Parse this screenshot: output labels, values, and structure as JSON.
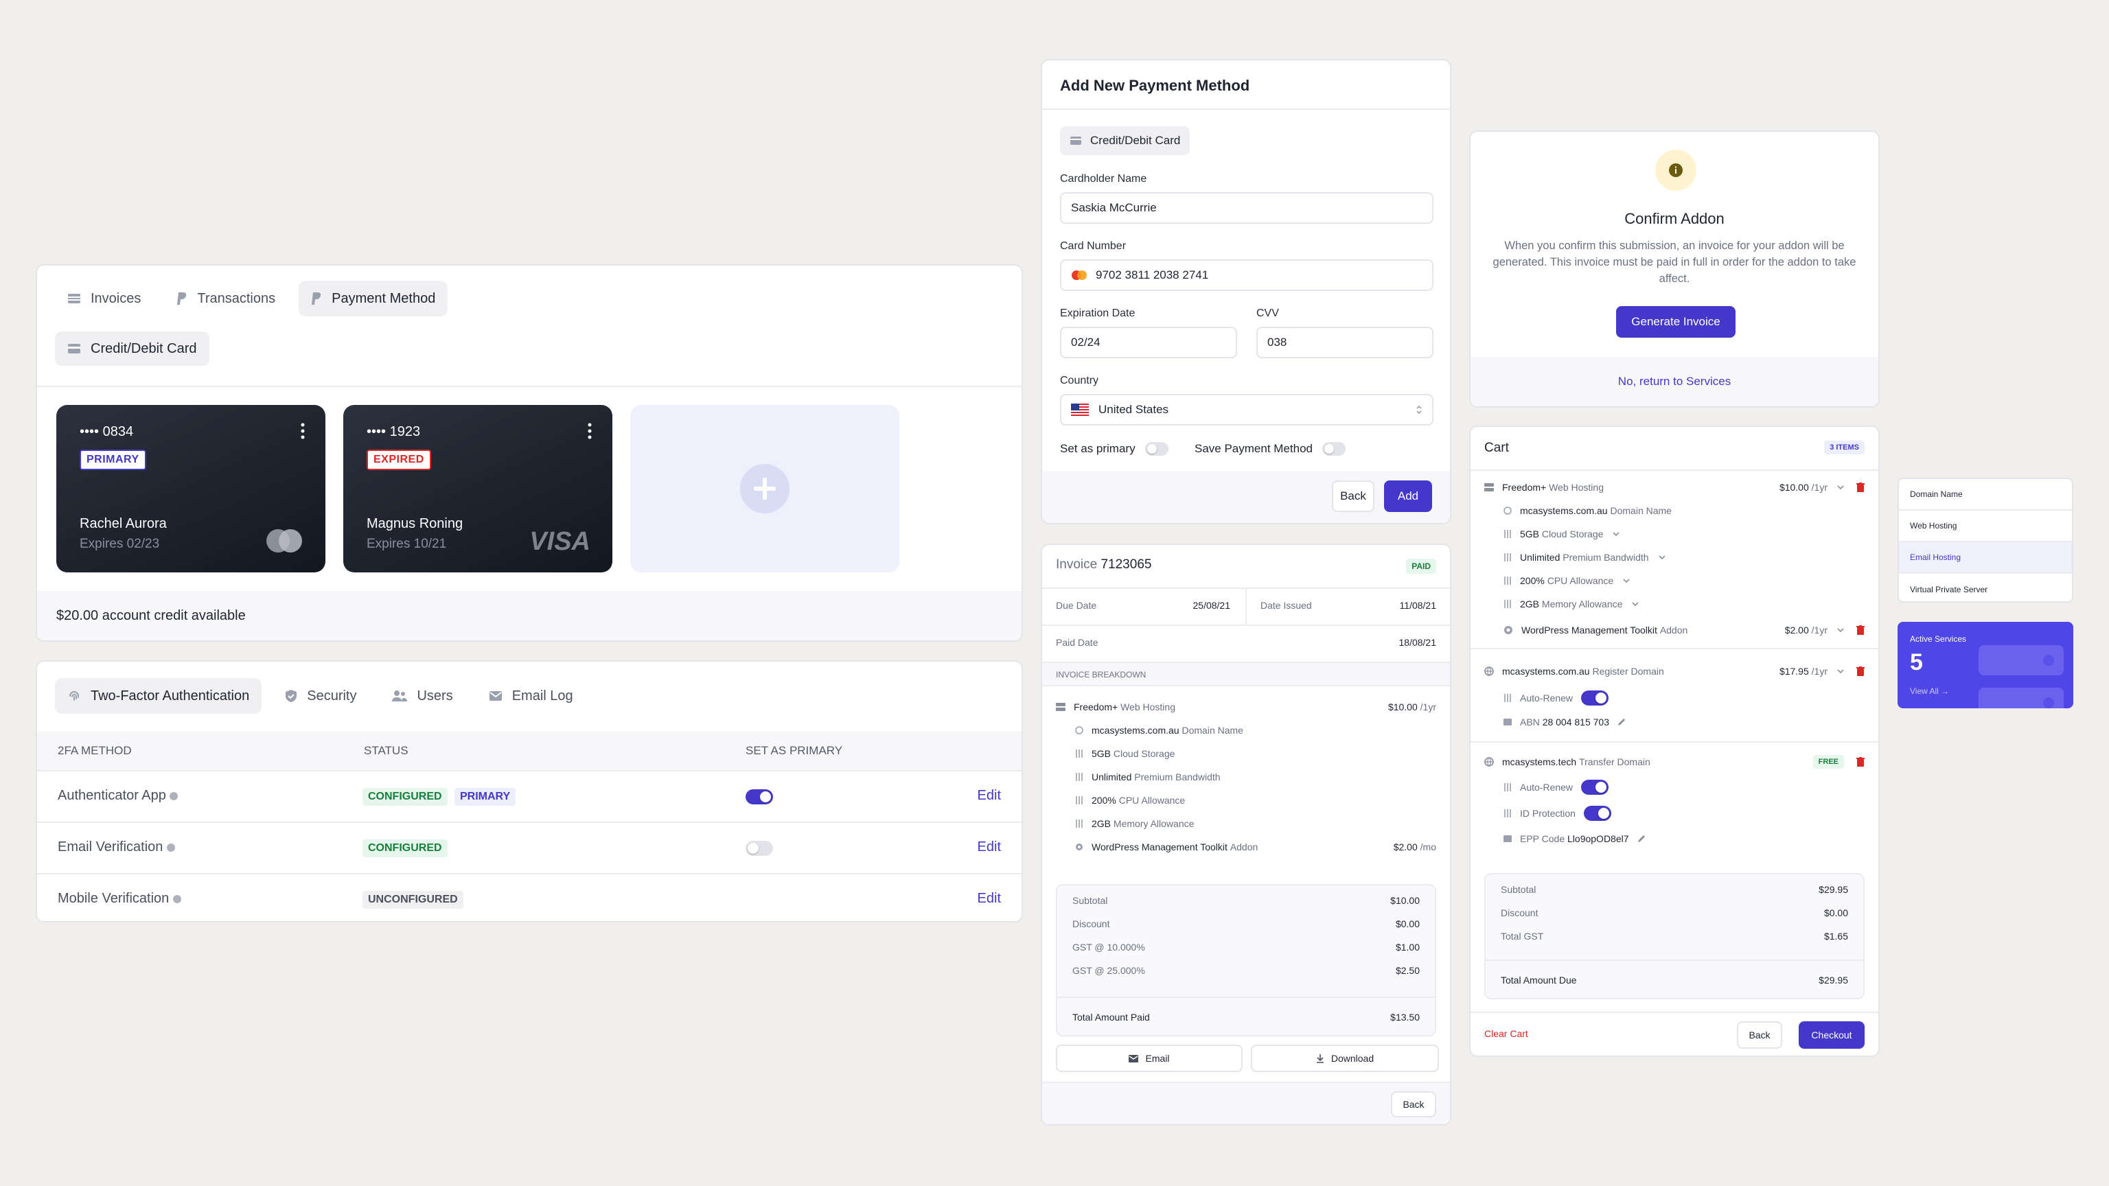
{
  "billing": {
    "tabs": [
      "Invoices",
      "Transactions",
      "Payment Method"
    ],
    "subtab": "Credit/Debit Card",
    "cards": [
      {
        "dots": "••••",
        "last4": "0834",
        "badge": "PRIMARY",
        "name": "Rachel Aurora",
        "expires": "Expires 02/23"
      },
      {
        "dots": "••••",
        "last4": "1923",
        "badge": "EXPIRED",
        "name": "Magnus Roning",
        "expires": "Expires 10/21",
        "brand": "VISA"
      }
    ],
    "credit_amount": "$20.00",
    "credit_text": "account credit available"
  },
  "security": {
    "tabs": [
      "Two-Factor Authentication",
      "Security",
      "Users",
      "Email Log"
    ],
    "headers": [
      "2FA METHOD",
      "STATUS",
      "SET AS PRIMARY"
    ],
    "rows": [
      {
        "method": "Authenticator App",
        "status": "CONFIGURED",
        "extra": "PRIMARY",
        "edit": "Edit"
      },
      {
        "method": "Email Verification",
        "status": "CONFIGURED",
        "edit": "Edit"
      },
      {
        "method": "Mobile Verification",
        "status": "UNCONFIGURED",
        "edit": "Edit"
      }
    ]
  },
  "payment": {
    "title": "Add New Payment Method",
    "type": "Credit/Debit Card",
    "cardholder_label": "Cardholder Name",
    "cardholder": "Saskia McCurrie",
    "number_label": "Card Number",
    "number": "9702 3811 2038 2741",
    "exp_label": "Expiration Date",
    "exp": "02/24",
    "cvv_label": "CVV",
    "cvv": "038",
    "country_label": "Country",
    "country": "United States",
    "primary_label": "Set as primary",
    "save_label": "Save Payment Method",
    "back": "Back",
    "add": "Add"
  },
  "invoice": {
    "title_prefix": "Invoice",
    "number": "7123065",
    "status": "PAID",
    "due_label": "Due Date",
    "due": "25/08/21",
    "issued_label": "Date Issued",
    "issued": "11/08/21",
    "paid_label": "Paid Date",
    "paid": "18/08/21",
    "breakdown": "INVOICE BREAKDOWN",
    "main": {
      "name": "Freedom+",
      "sub": "Web Hosting",
      "price": "$10.00",
      "unit": "/1yr"
    },
    "items": [
      {
        "b": "mcasystems.com.au",
        "t": "Domain Name"
      },
      {
        "b": "5GB",
        "t": "Cloud Storage"
      },
      {
        "b": "Unlimited",
        "t": "Premium Bandwidth"
      },
      {
        "b": "200%",
        "t": "CPU Allowance"
      },
      {
        "b": "2GB",
        "t": "Memory Allowance"
      },
      {
        "b": "WordPress Management Toolkit",
        "t": "Addon",
        "price": "$2.00",
        "unit": "/mo"
      }
    ],
    "totals": [
      {
        "l": "Subtotal",
        "v": "$10.00"
      },
      {
        "l": "Discount",
        "v": "$0.00"
      },
      {
        "l": "GST @ 10.000%",
        "v": "$1.00"
      },
      {
        "l": "GST @ 25.000%",
        "v": "$2.50"
      }
    ],
    "total_label": "Total Amount Paid",
    "total": "$13.50",
    "email": "Email",
    "download": "Download",
    "back": "Back"
  },
  "addon": {
    "title": "Confirm Addon",
    "text": "When you confirm this submission, an invoice for your addon will be generated. This invoice must be paid in full in order for the addon to take affect.",
    "button": "Generate Invoice",
    "link": "No, return to Services"
  },
  "cart": {
    "title": "Cart",
    "count": "3 ITEMS",
    "g1": {
      "name": "Freedom+",
      "sub": "Web Hosting",
      "price": "$10.00",
      "unit": "/1yr",
      "items": [
        {
          "b": "mcasystems.com.au",
          "t": "Domain Name"
        },
        {
          "b": "5GB",
          "t": "Cloud Storage"
        },
        {
          "b": "Unlimited",
          "t": "Premium Bandwidth"
        },
        {
          "b": "200%",
          "t": "CPU Allowance"
        },
        {
          "b": "2GB",
          "t": "Memory Allowance"
        }
      ],
      "addon": {
        "b": "WordPress Management Toolkit",
        "t": "Addon",
        "price": "$2.00",
        "unit": "/1yr"
      }
    },
    "g2": {
      "name": "mcasystems.com.au",
      "sub": "Register Domain",
      "price": "$17.95",
      "unit": "/1yr",
      "auto": "Auto-Renew",
      "abn_label": "ABN",
      "abn": "28 004 815 703"
    },
    "g3": {
      "name": "mcasystems.tech",
      "sub": "Transfer Domain",
      "badge": "FREE",
      "auto": "Auto-Renew",
      "idp": "ID Protection",
      "epp_label": "EPP Code",
      "epp": "Llo9opOD8el7"
    },
    "totals": [
      {
        "l": "Subtotal",
        "v": "$29.95"
      },
      {
        "l": "Discount",
        "v": "$0.00"
      },
      {
        "l": "Total GST",
        "v": "$1.65"
      }
    ],
    "total_label": "Total Amount Due",
    "total": "$29.95",
    "clear": "Clear Cart",
    "back": "Back",
    "checkout": "Checkout"
  },
  "menu": [
    "Domain Name",
    "Web Hosting",
    "Email Hosting",
    "Virtual Private Server"
  ],
  "active": {
    "label": "Active Services",
    "count": "5",
    "link": "View All →"
  },
  "colors": {
    "accent": "#4338ca",
    "green": "#15803d",
    "red": "#dc2626"
  }
}
